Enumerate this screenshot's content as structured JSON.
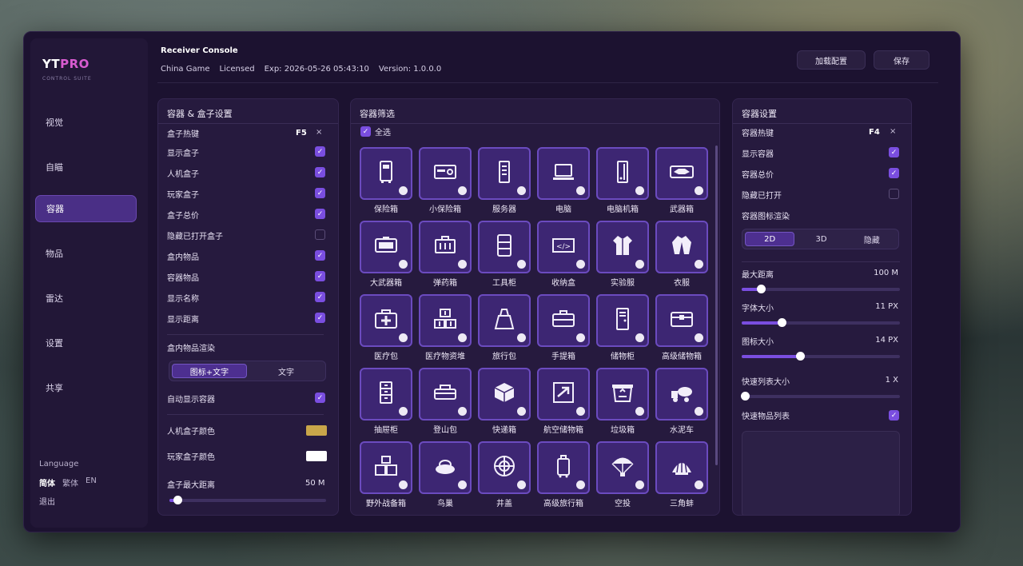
{
  "brand": {
    "name_a": "YT",
    "name_b": "PRO",
    "subtitle": "CONTROL SUITE"
  },
  "nav": [
    "视觉",
    "自瞄",
    "容器",
    "物品",
    "雷达",
    "设置",
    "共享"
  ],
  "nav_active": "容器",
  "language": {
    "title": "Language",
    "options": [
      "简体",
      "繁体",
      "EN"
    ],
    "selected": "简体",
    "logout": "退出"
  },
  "header": {
    "title": "Receiver Console",
    "region": "China Game",
    "license": "Licensed",
    "expiry": "Exp: 2026-05-26 05:43:10",
    "version": "Version: 1.0.0.0",
    "load_button": "加载配置",
    "save_button": "保存"
  },
  "box_panel": {
    "title": "容器 & 盒子设置",
    "hotkey_label": "盒子热键",
    "hotkey": "F5",
    "clear": "×",
    "toggles": [
      {
        "label": "显示盒子",
        "on": true
      },
      {
        "label": "人机盒子",
        "on": true
      },
      {
        "label": "玩家盒子",
        "on": true
      },
      {
        "label": "盒子总价",
        "on": true
      },
      {
        "label": "隐藏已打开盒子",
        "on": false
      },
      {
        "label": "盒内物品",
        "on": true
      },
      {
        "label": "容器物品",
        "on": true
      },
      {
        "label": "显示名称",
        "on": true
      },
      {
        "label": "显示距离",
        "on": true
      }
    ],
    "render_label": "盒内物品渲染",
    "render_options": [
      "图标+文字",
      "文字"
    ],
    "render_selected": "图标+文字",
    "auto_show_label": "自动显示容器",
    "auto_show_on": true,
    "ai_color_label": "人机盒子颜色",
    "ai_color": "#c9a64a",
    "player_color_label": "玩家盒子颜色",
    "player_color": "#ffffff",
    "max_dist_label": "盒子最大距离",
    "max_dist_value": "50 M",
    "max_dist_fraction": 0.05
  },
  "filter_panel": {
    "title": "容器筛选",
    "select_all": "全选",
    "select_all_on": true,
    "items": [
      {
        "label": "保险箱",
        "icon": "safe-icon"
      },
      {
        "label": "小保险箱",
        "icon": "small-safe-icon"
      },
      {
        "label": "服务器",
        "icon": "server-icon"
      },
      {
        "label": "电脑",
        "icon": "laptop-icon"
      },
      {
        "label": "电脑机箱",
        "icon": "pc-case-icon"
      },
      {
        "label": "武器箱",
        "icon": "weapon-case-icon"
      },
      {
        "label": "大武器箱",
        "icon": "large-weapon-case-icon"
      },
      {
        "label": "弹药箱",
        "icon": "ammo-box-icon"
      },
      {
        "label": "工具柜",
        "icon": "tool-cabinet-icon"
      },
      {
        "label": "收纳盒",
        "icon": "storage-box-icon"
      },
      {
        "label": "实验服",
        "icon": "lab-coat-icon"
      },
      {
        "label": "衣服",
        "icon": "jacket-icon"
      },
      {
        "label": "医疗包",
        "icon": "medkit-icon"
      },
      {
        "label": "医疗物资堆",
        "icon": "medical-supplies-icon"
      },
      {
        "label": "旅行包",
        "icon": "travel-bag-icon"
      },
      {
        "label": "手提箱",
        "icon": "briefcase-icon"
      },
      {
        "label": "储物柜",
        "icon": "locker-icon"
      },
      {
        "label": "高级储物箱",
        "icon": "premium-storage-icon"
      },
      {
        "label": "抽屉柜",
        "icon": "drawer-cabinet-icon"
      },
      {
        "label": "登山包",
        "icon": "hiking-bag-icon"
      },
      {
        "label": "快递箱",
        "icon": "parcel-icon"
      },
      {
        "label": "航空储物箱",
        "icon": "air-cargo-icon"
      },
      {
        "label": "垃圾箱",
        "icon": "trash-bin-icon"
      },
      {
        "label": "水泥车",
        "icon": "cement-truck-icon"
      },
      {
        "label": "野外战备箱",
        "icon": "field-crates-icon"
      },
      {
        "label": "鸟巢",
        "icon": "bird-nest-icon"
      },
      {
        "label": "井盖",
        "icon": "manhole-icon"
      },
      {
        "label": "高级旅行箱",
        "icon": "suitcase-icon"
      },
      {
        "label": "空投",
        "icon": "airdrop-icon"
      },
      {
        "label": "三角蚌",
        "icon": "clam-icon"
      }
    ]
  },
  "container_panel": {
    "title": "容器设置",
    "hotkey_label": "容器热键",
    "hotkey": "F4",
    "clear": "×",
    "toggles": [
      {
        "label": "显示容器",
        "on": true
      },
      {
        "label": "容器总价",
        "on": true
      },
      {
        "label": "隐藏已打开",
        "on": false
      }
    ],
    "render_label": "容器图标渲染",
    "render_options": [
      "2D",
      "3D",
      "隐藏"
    ],
    "render_selected": "2D",
    "sliders": [
      {
        "label": "最大距离",
        "value": "100 M",
        "fraction": 0.12
      },
      {
        "label": "字体大小",
        "value": "11 PX",
        "fraction": 0.25
      },
      {
        "label": "图标大小",
        "value": "14 PX",
        "fraction": 0.37
      },
      {
        "label": "快速列表大小",
        "value": "1 X",
        "fraction": 0.02
      }
    ],
    "quick_list_label": "快速物品列表",
    "quick_list_on": true
  },
  "colors": {
    "accent": "#7a4ee0",
    "panel": "#261a3e",
    "tile": "#3d2673",
    "tile_border": "#6b4bbf"
  }
}
